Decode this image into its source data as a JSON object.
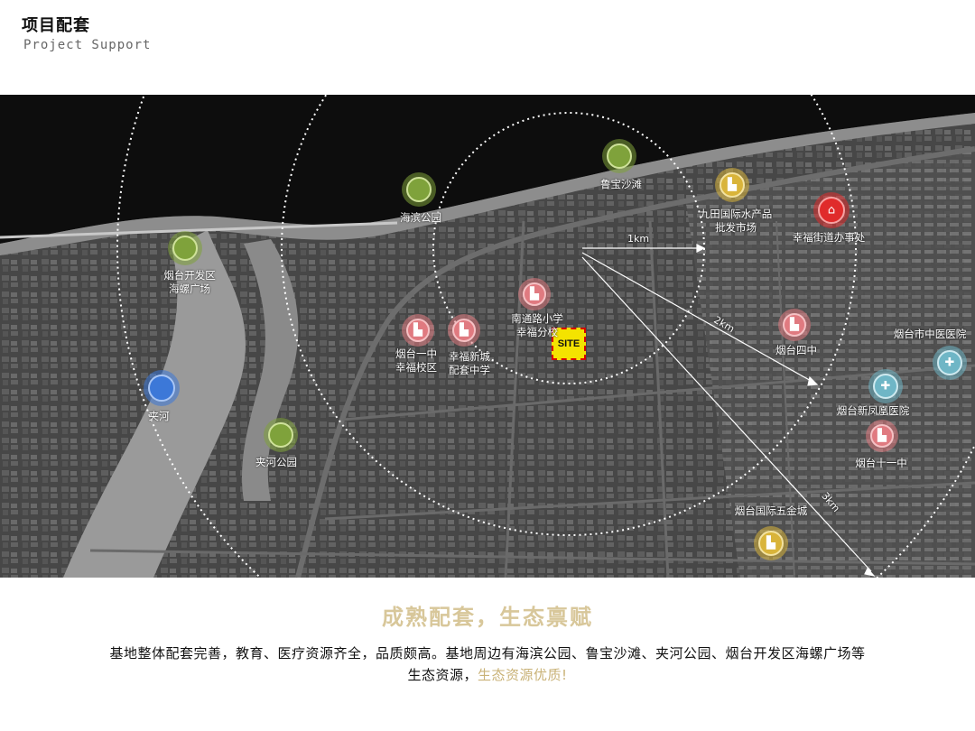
{
  "header": {
    "title": "项目配套",
    "subtitle": "Project Support"
  },
  "map": {
    "site_label": "SITE",
    "distances": [
      "1km",
      "2km",
      "3km"
    ],
    "pois": [
      {
        "id": "haibin-park",
        "label": [
          "海滨公园"
        ],
        "category": "park",
        "color": "#7fa23b"
      },
      {
        "id": "lubao-beach",
        "label": [
          "鲁宝沙滩"
        ],
        "category": "park",
        "color": "#7fa23b"
      },
      {
        "id": "kaifaqu-plaza",
        "label": [
          "烟台开发区",
          "海螺广场"
        ],
        "category": "park",
        "color": "#7fa23b"
      },
      {
        "id": "jiahe-park",
        "label": [
          "夹河公园"
        ],
        "category": "park",
        "color": "#7fa23b"
      },
      {
        "id": "jiahe",
        "label": [
          "夹河"
        ],
        "category": "water",
        "color": "#3c78d8"
      },
      {
        "id": "jiutian-market",
        "label": [
          "九田国际水产品",
          "批发市场"
        ],
        "category": "commerce",
        "color": "#d9b43a"
      },
      {
        "id": "wujin-city",
        "label": [
          "烟台国际五金城"
        ],
        "category": "commerce",
        "color": "#d9b43a"
      },
      {
        "id": "xingfu-office",
        "label": [
          "幸福街道办事处"
        ],
        "category": "government",
        "color": "#e02b2b"
      },
      {
        "id": "nantonglu-school",
        "label": [
          "南通路小学",
          "幸福分校"
        ],
        "category": "education",
        "color": "#e07a80"
      },
      {
        "id": "yantai-no1",
        "label": [
          "烟台一中",
          "幸福校区"
        ],
        "category": "education",
        "color": "#e07a80"
      },
      {
        "id": "xingfu-middle",
        "label": [
          "幸福新城",
          "配套中学"
        ],
        "category": "education",
        "color": "#e07a80"
      },
      {
        "id": "yantai-no4",
        "label": [
          "烟台四中"
        ],
        "category": "education",
        "color": "#e07a80"
      },
      {
        "id": "yantai-no11",
        "label": [
          "烟台十一中"
        ],
        "category": "education",
        "color": "#e07a80"
      },
      {
        "id": "tcm-hospital",
        "label": [
          "烟台市中医医院"
        ],
        "category": "medical",
        "color": "#6fb6c6"
      },
      {
        "id": "xinfenghuang-hospital",
        "label": [
          "烟台新凤凰医院"
        ],
        "category": "medical",
        "color": "#6fb6c6"
      }
    ]
  },
  "slogan": "成熟配套，生态禀赋",
  "description": {
    "main": "基地整体配套完善，教育、医疗资源齐全，品质颇高。基地周边有海滨公园、鲁宝沙滩、夹河公园、烟台开发区海螺广场等",
    "line2_prefix": "生态资源，",
    "highlight": "生态资源优质!"
  }
}
